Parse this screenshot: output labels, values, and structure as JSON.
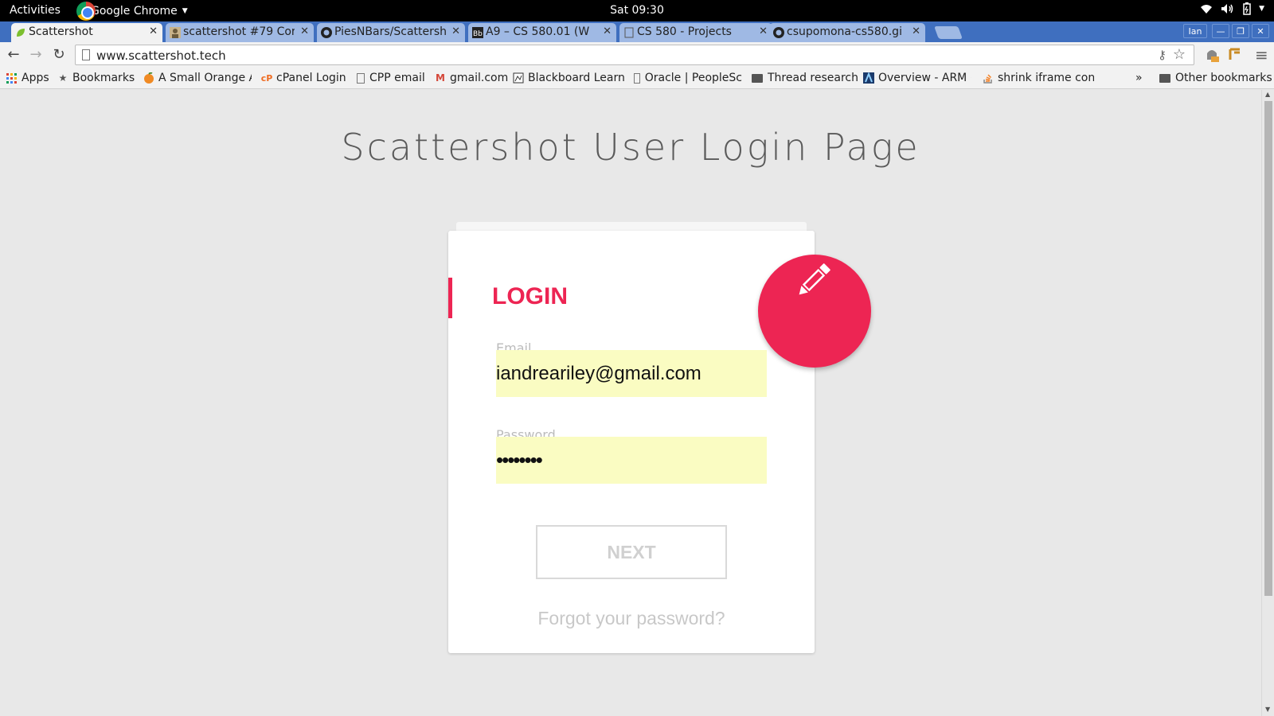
{
  "topbar": {
    "activities": "Activities",
    "app_name": "Google Chrome",
    "clock": "Sat 09:30"
  },
  "tabs": [
    {
      "title": "Scattershot",
      "favicon": "leaf-icon",
      "active": true
    },
    {
      "title": "scattershot #79 Cor",
      "favicon": "avatar-icon",
      "active": false
    },
    {
      "title": "PiesNBars/Scattersh",
      "favicon": "github-icon",
      "active": false
    },
    {
      "title": "A9 – CS 580.01 (W",
      "favicon": "blackboard-icon",
      "active": false
    },
    {
      "title": "CS 580 - Projects",
      "favicon": "page-icon",
      "active": false
    },
    {
      "title": "csupomona-cs580.gi",
      "favicon": "github-icon",
      "active": false
    }
  ],
  "window_user": "Ian",
  "toolbar": {
    "url": "www.scattershot.tech"
  },
  "bookmarks": {
    "items": [
      {
        "label": "Apps",
        "icon": "apps-grid-icon"
      },
      {
        "label": "Bookmarks",
        "icon": "star-icon"
      },
      {
        "label": "A Small Orange A",
        "icon": "orange-icon"
      },
      {
        "label": "cPanel Login",
        "icon": "cpanel-icon"
      },
      {
        "label": "CPP email",
        "icon": "page-icon"
      },
      {
        "label": "gmail.com",
        "icon": "gmail-icon"
      },
      {
        "label": "Blackboard Learn",
        "icon": "blackboard-icon"
      },
      {
        "label": "Oracle | PeopleSc",
        "icon": "page-icon"
      },
      {
        "label": "Thread research",
        "icon": "folder-icon"
      },
      {
        "label": "Overview - ARM (",
        "icon": "arm-icon"
      },
      {
        "label": "shrink iframe cont",
        "icon": "stackoverflow-icon"
      }
    ],
    "overflow": "»",
    "other": "Other bookmarks"
  },
  "page": {
    "title": "Scattershot User Login Page",
    "login_heading": "LOGIN",
    "email_label": "Email",
    "email_value": "iandreariley@gmail.com",
    "password_label": "Password",
    "password_value": "••••••••",
    "next_label": "NEXT",
    "forgot_label": "Forgot your password?"
  },
  "colors": {
    "accent": "#ed2553",
    "autofill": "#fafcc2",
    "tabstrip": "#3f6fbf"
  }
}
